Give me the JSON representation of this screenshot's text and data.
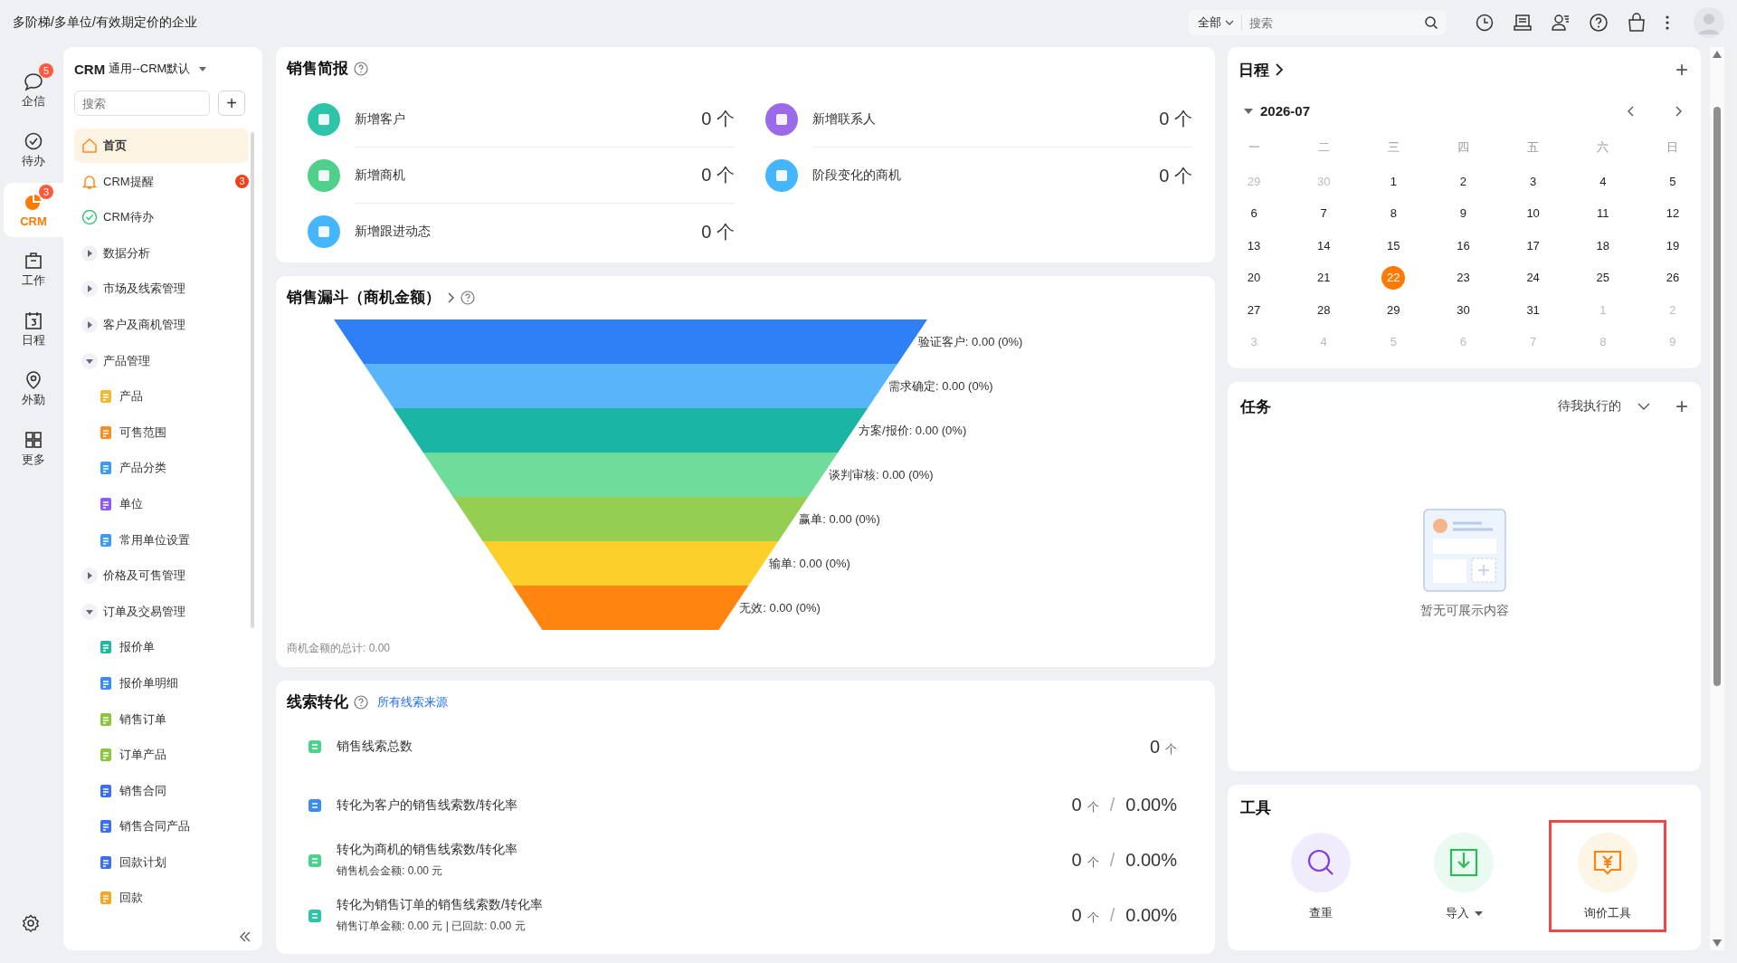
{
  "page_title": "多阶梯/多单位/有效期定价的企业",
  "top_search": {
    "scope": "全部",
    "placeholder": "搜索"
  },
  "rail": [
    {
      "label": "企信",
      "badge": "5",
      "selected": false
    },
    {
      "label": "待办",
      "selected": false
    },
    {
      "label": "CRM",
      "badge": "3",
      "selected": true
    },
    {
      "label": "工作",
      "selected": false
    },
    {
      "label": "日程",
      "selected": false
    },
    {
      "label": "外勤",
      "selected": false
    },
    {
      "label": "更多",
      "selected": false
    }
  ],
  "sidebar": {
    "app": "CRM",
    "workspace": "通用--CRM默认",
    "search_placeholder": "搜索",
    "add": "+",
    "items": [
      {
        "kind": "link",
        "label": "首页",
        "selected": true
      },
      {
        "kind": "link",
        "label": "CRM提醒",
        "badge": "3",
        "selected": false
      },
      {
        "kind": "link",
        "label": "CRM待办",
        "selected": false
      },
      {
        "kind": "group",
        "label": "数据分析",
        "expanded": false
      },
      {
        "kind": "group",
        "label": "市场及线索管理",
        "expanded": false
      },
      {
        "kind": "group",
        "label": "客户及商机管理",
        "expanded": false
      },
      {
        "kind": "group",
        "label": "产品管理",
        "expanded": true,
        "children": [
          {
            "label": "产品",
            "color": "#f5b82e",
            "selected": false
          },
          {
            "label": "可售范围",
            "color": "#ff8a1f",
            "selected": false
          },
          {
            "label": "产品分类",
            "color": "#3a9bf5",
            "selected": false
          },
          {
            "label": "单位",
            "color": "#8b5cf6",
            "selected": false
          },
          {
            "label": "常用单位设置",
            "color": "#3a9bf5",
            "selected": false
          }
        ]
      },
      {
        "kind": "group",
        "label": "价格及可售管理",
        "expanded": false
      },
      {
        "kind": "group",
        "label": "订单及交易管理",
        "expanded": true,
        "children": [
          {
            "label": "报价单",
            "color": "#22b8a0",
            "selected": false
          },
          {
            "label": "报价单明细",
            "color": "#3a8cf5",
            "selected": false
          },
          {
            "label": "销售订单",
            "color": "#8cc63f",
            "selected": false
          },
          {
            "label": "订单产品",
            "color": "#8cc63f",
            "selected": false
          },
          {
            "label": "销售合同",
            "color": "#3a6ff5",
            "selected": false
          },
          {
            "label": "销售合同产品",
            "color": "#3a6ff5",
            "selected": false
          },
          {
            "label": "回款计划",
            "color": "#3a6ff5",
            "selected": false
          },
          {
            "label": "回款",
            "color": "#f5a623",
            "selected": false
          }
        ]
      }
    ]
  },
  "sales_report": {
    "title": "销售简报",
    "left": [
      {
        "label": "新增客户",
        "value": "0 个",
        "color": "#2ec4a9"
      },
      {
        "label": "新增商机",
        "value": "0 个",
        "color": "#4fd18b"
      },
      {
        "label": "新增跟进动态",
        "value": "0 个",
        "color": "#45b6fe"
      }
    ],
    "right": [
      {
        "label": "新增联系人",
        "value": "0 个",
        "color": "#9a6ae8"
      },
      {
        "label": "阶段变化的商机",
        "value": "0 个",
        "color": "#45b6fe"
      }
    ]
  },
  "funnel": {
    "title": "销售漏斗（商机金额）",
    "stages": [
      {
        "label": "验证客户: 0.00 (0%)",
        "color": "#2f7ff5"
      },
      {
        "label": "需求确定: 0.00 (0%)",
        "color": "#5ab4fa"
      },
      {
        "label": "方案/报价: 0.00 (0%)",
        "color": "#1bb5a6"
      },
      {
        "label": "谈判审核: 0.00 (0%)",
        "color": "#6fdc9b"
      },
      {
        "label": "赢单: 0.00 (0%)",
        "color": "#95cf52"
      },
      {
        "label": "输单: 0.00 (0%)",
        "color": "#fdcf2a"
      },
      {
        "label": "无效: 0.00 (0%)",
        "color": "#ff8410"
      }
    ],
    "total": "商机金额的总计: 0.00"
  },
  "lead_conversion": {
    "title": "线索转化",
    "link": "所有线索来源",
    "rows": [
      {
        "label": "销售线索总数",
        "count": "0",
        "unit": "个",
        "color": "#4fd18b"
      },
      {
        "label": "转化为客户的销售线索数/转化率",
        "count": "0",
        "unit": "个",
        "separator": "/",
        "rate": "0.00%",
        "color": "#3a8cf5"
      },
      {
        "label": "转化为商机的销售线索数/转化率",
        "note": "销售机会金额: 0.00 元",
        "count": "0",
        "unit": "个",
        "separator": "/",
        "rate": "0.00%",
        "color": "#4fd18b"
      },
      {
        "label": "转化为销售订单的销售线索数/转化率",
        "note": "销售订单金额: 0.00 元 | 已回款: 0.00 元",
        "count": "0",
        "unit": "个",
        "separator": "/",
        "rate": "0.00%",
        "color": "#2ec4a9"
      }
    ]
  },
  "schedule": {
    "title": "日程",
    "month": "2026-07",
    "add": "+",
    "weekdays": [
      "一",
      "二",
      "三",
      "四",
      "五",
      "六",
      "日"
    ],
    "days": [
      {
        "day": "29",
        "in_month": false,
        "selected": false
      },
      {
        "day": "30",
        "in_month": false,
        "selected": false
      },
      {
        "day": "1",
        "in_month": true,
        "selected": false
      },
      {
        "day": "2",
        "in_month": true,
        "selected": false
      },
      {
        "day": "3",
        "in_month": true,
        "selected": false
      },
      {
        "day": "4",
        "in_month": true,
        "selected": false
      },
      {
        "day": "5",
        "in_month": true,
        "selected": false
      },
      {
        "day": "6",
        "in_month": true,
        "selected": false
      },
      {
        "day": "7",
        "in_month": true,
        "selected": false
      },
      {
        "day": "8",
        "in_month": true,
        "selected": false
      },
      {
        "day": "9",
        "in_month": true,
        "selected": false
      },
      {
        "day": "10",
        "in_month": true,
        "selected": false
      },
      {
        "day": "11",
        "in_month": true,
        "selected": false
      },
      {
        "day": "12",
        "in_month": true,
        "selected": false
      },
      {
        "day": "13",
        "in_month": true,
        "selected": false
      },
      {
        "day": "14",
        "in_month": true,
        "selected": false
      },
      {
        "day": "15",
        "in_month": true,
        "selected": false
      },
      {
        "day": "16",
        "in_month": true,
        "selected": false
      },
      {
        "day": "17",
        "in_month": true,
        "selected": false
      },
      {
        "day": "18",
        "in_month": true,
        "selected": false
      },
      {
        "day": "19",
        "in_month": true,
        "selected": false
      },
      {
        "day": "20",
        "in_month": true,
        "selected": false
      },
      {
        "day": "21",
        "in_month": true,
        "selected": false
      },
      {
        "day": "22",
        "in_month": true,
        "selected": true
      },
      {
        "day": "23",
        "in_month": true,
        "selected": false
      },
      {
        "day": "24",
        "in_month": true,
        "selected": false
      },
      {
        "day": "25",
        "in_month": true,
        "selected": false
      },
      {
        "day": "26",
        "in_month": true,
        "selected": false
      },
      {
        "day": "27",
        "in_month": true,
        "selected": false
      },
      {
        "day": "28",
        "in_month": true,
        "selected": false
      },
      {
        "day": "29",
        "in_month": true,
        "selected": false
      },
      {
        "day": "30",
        "in_month": true,
        "selected": false
      },
      {
        "day": "31",
        "in_month": true,
        "selected": false
      },
      {
        "day": "1",
        "in_month": false,
        "selected": false
      },
      {
        "day": "2",
        "in_month": false,
        "selected": false
      },
      {
        "day": "3",
        "in_month": false,
        "selected": false
      },
      {
        "day": "4",
        "in_month": false,
        "selected": false
      },
      {
        "day": "5",
        "in_month": false,
        "selected": false
      },
      {
        "day": "6",
        "in_month": false,
        "selected": false
      },
      {
        "day": "7",
        "in_month": false,
        "selected": false
      },
      {
        "day": "8",
        "in_month": false,
        "selected": false
      },
      {
        "day": "9",
        "in_month": false,
        "selected": false
      }
    ]
  },
  "tasks": {
    "title": "任务",
    "filter": "待我执行的",
    "add": "+",
    "empty": "暂无可展示内容"
  },
  "tools": {
    "title": "工具",
    "items": [
      {
        "label": "查重",
        "color": "#f1ecfd",
        "dropdown": false,
        "highlighted": false
      },
      {
        "label": "导入",
        "color": "#eafaf0",
        "dropdown": true,
        "highlighted": false
      },
      {
        "label": "询价工具",
        "color": "#fdf5e6",
        "dropdown": false,
        "highlighted": true
      }
    ]
  }
}
